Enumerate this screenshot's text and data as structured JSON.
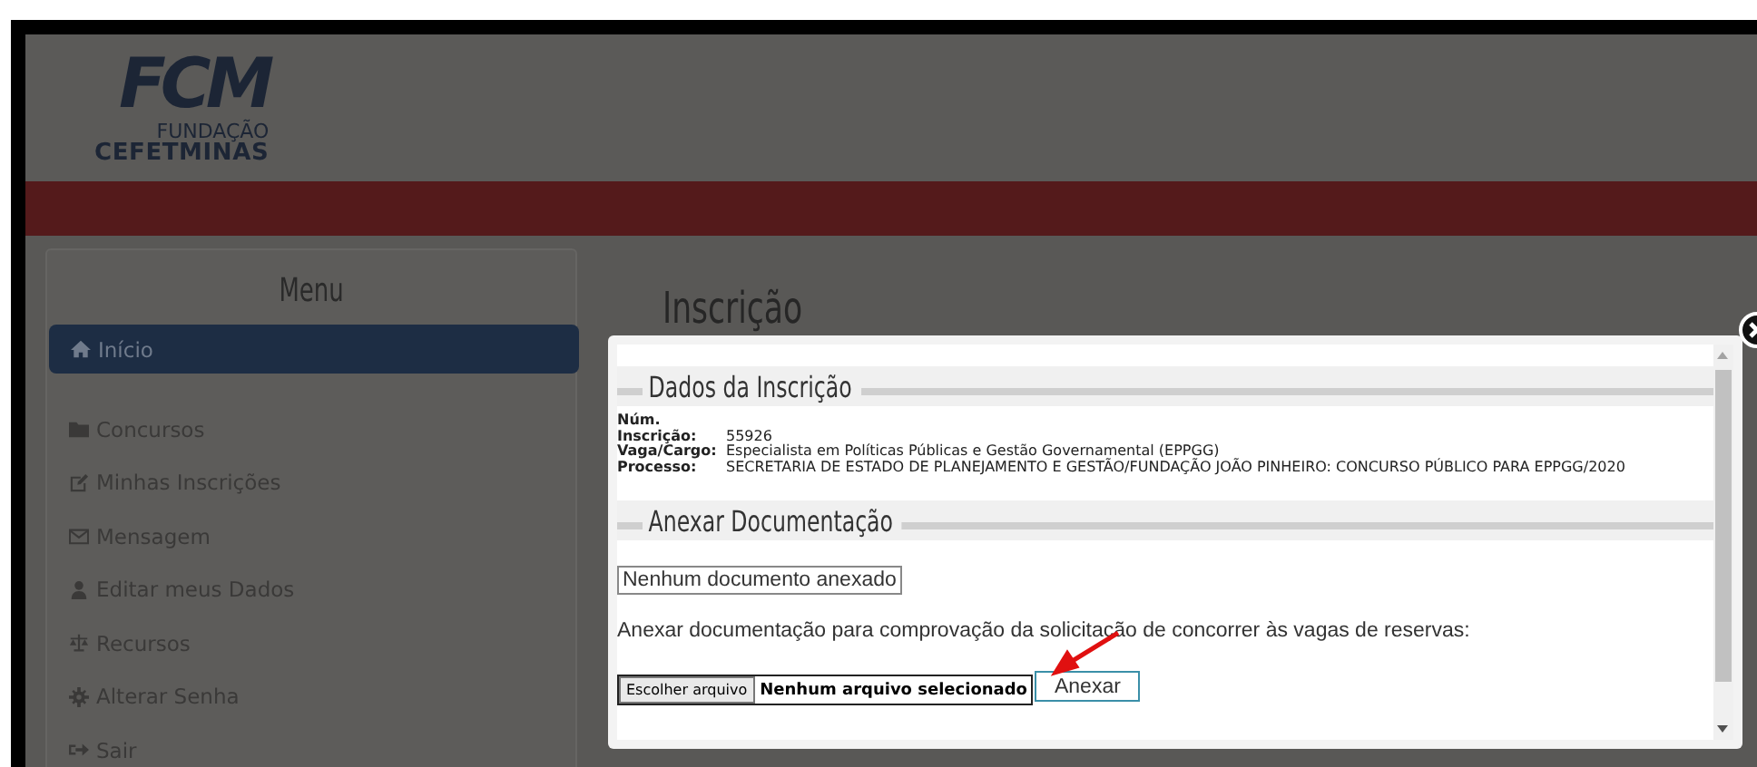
{
  "logo": {
    "letters": "FCM",
    "line1": "FUNDAÇÃO",
    "line2": "CEFETMINAS"
  },
  "menu": {
    "title": "Menu",
    "items": [
      {
        "label": "Início",
        "kind": "home",
        "selected": true
      },
      {
        "label": "Concursos",
        "kind": "folder",
        "selected": false
      },
      {
        "label": "Minhas Inscrições",
        "kind": "edit",
        "selected": false
      },
      {
        "label": "Mensagem",
        "kind": "envelope",
        "selected": false
      },
      {
        "label": "Editar meus Dados",
        "kind": "user",
        "selected": false
      },
      {
        "label": "Recursos",
        "kind": "scale",
        "selected": false
      },
      {
        "label": "Alterar Senha",
        "kind": "gear",
        "selected": false
      },
      {
        "label": "Sair",
        "kind": "signout",
        "selected": false
      }
    ]
  },
  "page_title": "Inscrição",
  "modal": {
    "sections": [
      {
        "kind": "details",
        "title": "Dados da Inscrição",
        "fields": [
          {
            "label": "Núm. Inscrição:",
            "value": "55926"
          },
          {
            "label": "Vaga/Cargo:",
            "value": "Especialista em Políticas Públicas e Gestão Governamental (EPPGG)"
          },
          {
            "label": "Processo:",
            "value": "SECRETARIA DE ESTADO DE PLANEJAMENTO E GESTÃO/FUNDAÇÃO JOÃO PINHEIRO: CONCURSO PÚBLICO PARA EPPGG/2020"
          }
        ]
      },
      {
        "kind": "upload",
        "title": "Anexar Documentação",
        "status": "Nenhum documento anexado",
        "instruction": "Anexar documentação para comprovação da solicitação de concorrer às vagas de reservas:",
        "choose_button": "Escolher arquivo",
        "file_name": "Nenhum arquivo selecionado",
        "submit_button": "Anexar"
      }
    ]
  }
}
